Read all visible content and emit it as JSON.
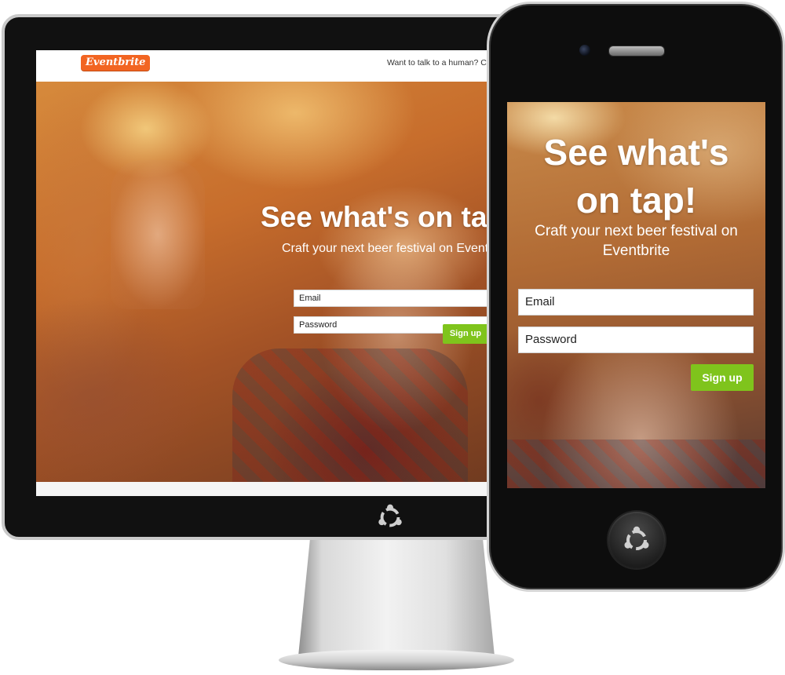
{
  "brand": {
    "logo_text": "Eventbrite",
    "accent_color": "#f26522",
    "cta_color": "#7fc41c"
  },
  "desktop": {
    "header": {
      "contact_text": "Want to talk to a human? Cal"
    },
    "hero": {
      "title": "See what's on ta",
      "subtitle": "Craft your next beer festival on Eventbri"
    },
    "form": {
      "email_placeholder": "Email",
      "password_placeholder": "Password",
      "signup_label": "Sign up"
    }
  },
  "mobile": {
    "hero": {
      "title_line1": "See what's",
      "title_line2": "on tap!",
      "subtitle_line1": "Craft your next beer festival on",
      "subtitle_line2": "Eventbrite"
    },
    "form": {
      "email_placeholder": "Email",
      "password_placeholder": "Password",
      "signup_label": "Sign up"
    }
  },
  "icons": {
    "monitor_logo": "ubuntu-circle-of-friends-icon",
    "phone_home_logo": "ubuntu-circle-of-friends-icon",
    "phone_camera": "camera-icon",
    "phone_speaker": "speaker-icon"
  }
}
